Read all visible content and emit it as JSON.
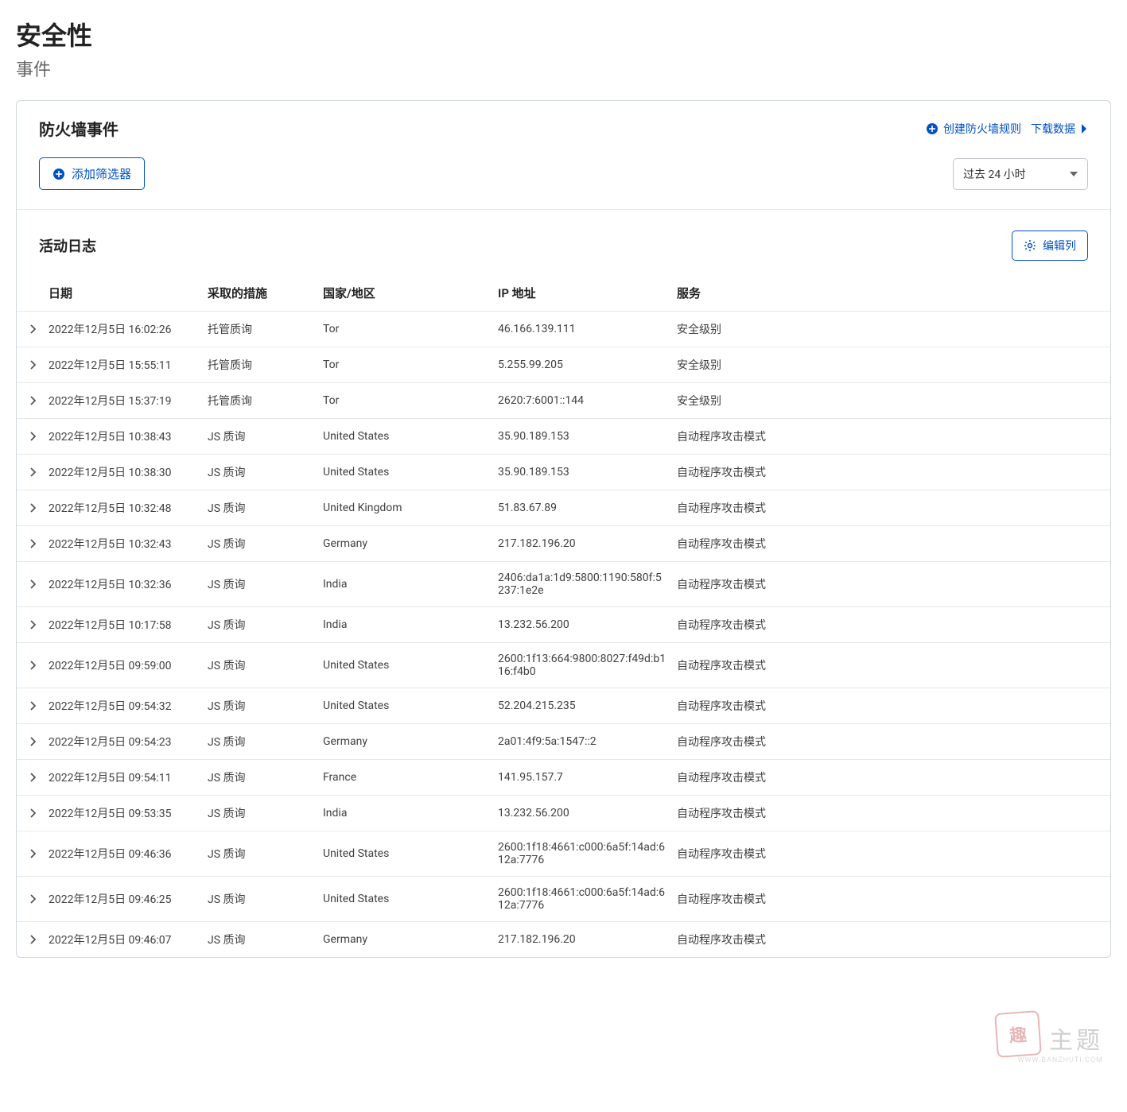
{
  "page": {
    "title": "安全性",
    "subtitle": "事件"
  },
  "firewall": {
    "title": "防火墙事件",
    "create_rule": "创建防火墙规则",
    "download": "下载数据",
    "add_filter": "添加筛选器",
    "time_range": "过去 24 小时"
  },
  "log": {
    "title": "活动日志",
    "edit_columns": "编辑列",
    "headers": {
      "date": "日期",
      "action": "采取的措施",
      "country": "国家/地区",
      "ip": "IP 地址",
      "service": "服务"
    },
    "rows": [
      {
        "date": "2022年12月5日 16:02:26",
        "action": "托管质询",
        "country": "Tor",
        "ip": "46.166.139.111",
        "service": "安全级别"
      },
      {
        "date": "2022年12月5日 15:55:11",
        "action": "托管质询",
        "country": "Tor",
        "ip": "5.255.99.205",
        "service": "安全级别"
      },
      {
        "date": "2022年12月5日 15:37:19",
        "action": "托管质询",
        "country": "Tor",
        "ip": "2620:7:6001::144",
        "service": "安全级别"
      },
      {
        "date": "2022年12月5日 10:38:43",
        "action": "JS 质询",
        "country": "United States",
        "ip": "35.90.189.153",
        "service": "自动程序攻击模式"
      },
      {
        "date": "2022年12月5日 10:38:30",
        "action": "JS 质询",
        "country": "United States",
        "ip": "35.90.189.153",
        "service": "自动程序攻击模式"
      },
      {
        "date": "2022年12月5日 10:32:48",
        "action": "JS 质询",
        "country": "United Kingdom",
        "ip": "51.83.67.89",
        "service": "自动程序攻击模式"
      },
      {
        "date": "2022年12月5日 10:32:43",
        "action": "JS 质询",
        "country": "Germany",
        "ip": "217.182.196.20",
        "service": "自动程序攻击模式"
      },
      {
        "date": "2022年12月5日 10:32:36",
        "action": "JS 质询",
        "country": "India",
        "ip": "2406:da1a:1d9:5800:1190:580f:5237:1e2e",
        "service": "自动程序攻击模式"
      },
      {
        "date": "2022年12月5日 10:17:58",
        "action": "JS 质询",
        "country": "India",
        "ip": "13.232.56.200",
        "service": "自动程序攻击模式"
      },
      {
        "date": "2022年12月5日 09:59:00",
        "action": "JS 质询",
        "country": "United States",
        "ip": "2600:1f13:664:9800:8027:f49d:b116:f4b0",
        "service": "自动程序攻击模式"
      },
      {
        "date": "2022年12月5日 09:54:32",
        "action": "JS 质询",
        "country": "United States",
        "ip": "52.204.215.235",
        "service": "自动程序攻击模式"
      },
      {
        "date": "2022年12月5日 09:54:23",
        "action": "JS 质询",
        "country": "Germany",
        "ip": "2a01:4f9:5a:1547::2",
        "service": "自动程序攻击模式"
      },
      {
        "date": "2022年12月5日 09:54:11",
        "action": "JS 质询",
        "country": "France",
        "ip": "141.95.157.7",
        "service": "自动程序攻击模式"
      },
      {
        "date": "2022年12月5日 09:53:35",
        "action": "JS 质询",
        "country": "India",
        "ip": "13.232.56.200",
        "service": "自动程序攻击模式"
      },
      {
        "date": "2022年12月5日 09:46:36",
        "action": "JS 质询",
        "country": "United States",
        "ip": "2600:1f18:4661:c000:6a5f:14ad:612a:7776",
        "service": "自动程序攻击模式"
      },
      {
        "date": "2022年12月5日 09:46:25",
        "action": "JS 质询",
        "country": "United States",
        "ip": "2600:1f18:4661:c000:6a5f:14ad:612a:7776",
        "service": "自动程序攻击模式"
      },
      {
        "date": "2022年12月5日 09:46:07",
        "action": "JS 质询",
        "country": "Germany",
        "ip": "217.182.196.20",
        "service": "自动程序攻击模式"
      }
    ]
  },
  "watermark": {
    "seal": "趣",
    "text": "主题",
    "sub": "WWW.BANZHUTI.COM"
  }
}
